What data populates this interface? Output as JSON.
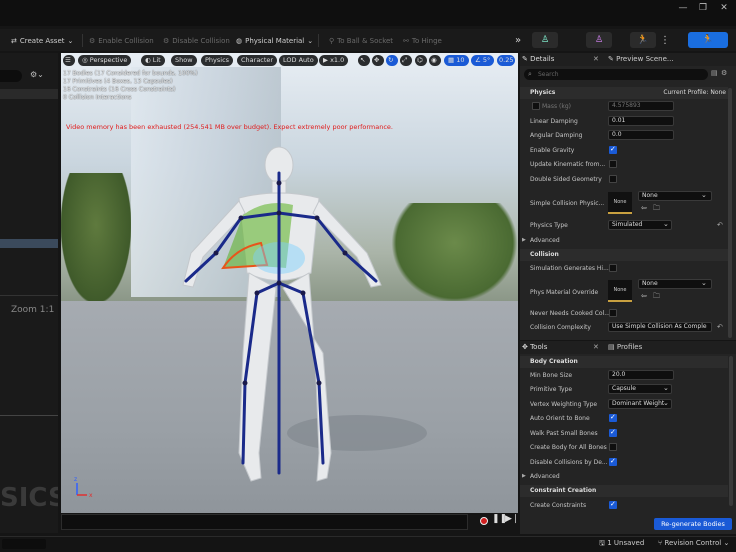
{
  "window": {
    "minimize": "—",
    "restore": "❐",
    "close": "✕"
  },
  "toolbar": {
    "create_asset": "Create Asset",
    "enable_collision": "Enable Collision",
    "disable_collision": "Disable Collision",
    "physical_material": "Physical Material",
    "to_ball_socket": "To Ball & Socket",
    "to_hinge": "To Hinge"
  },
  "left_panel": {
    "zoom": "Zoom 1:1",
    "watermark": "SICS"
  },
  "viewport": {
    "buttons": {
      "perspective": "Perspective",
      "lit": "Lit",
      "show": "Show",
      "physics": "Physics",
      "character": "Character",
      "lod": "LOD Auto",
      "play_speed": "x1.0",
      "grid": "10",
      "angle": "5°",
      "scale": "0.25"
    },
    "stats": [
      "17 Bodies (17 Considered for bounds, 100%)",
      "17 Primitives (4 Boxes, 13 Capsules)",
      "16 Constraints (16 Cross Constraints)",
      "0 Collision Interactions"
    ],
    "warning": "Video memory has been exhausted (254.541 MB over budget). Expect extremely poor performance."
  },
  "details": {
    "tab_details": "Details",
    "tab_preview": "Preview Scene...",
    "search_placeholder": "Search",
    "physics_section": "Physics",
    "current_profile": "Current Profile: None",
    "mass_label": "Mass (kg)",
    "mass_value": "4.575893",
    "linear_damping_label": "Linear Damping",
    "linear_damping_value": "0.01",
    "angular_damping_label": "Angular Damping",
    "angular_damping_value": "0.0",
    "enable_gravity": "Enable Gravity",
    "update_kinematic": "Update Kinematic from...",
    "double_sided": "Double Sided Geometry",
    "simple_collision_label": "Simple Collision Physic...",
    "simple_collision_thumb": "None",
    "simple_collision_value": "None",
    "physics_type_label": "Physics Type",
    "physics_type_value": "Simulated",
    "advanced": "Advanced",
    "collision_section": "Collision",
    "sim_generates_hit": "Simulation Generates Hi...",
    "phys_material_label": "Phys Material Override",
    "phys_material_thumb": "None",
    "phys_material_value": "None",
    "never_cooked": "Never Needs Cooked Col...",
    "collision_complexity_label": "Collision Complexity",
    "collision_complexity_value": "Use Simple Collision As Comple"
  },
  "tools": {
    "tab_tools": "Tools",
    "tab_profiles": "Profiles",
    "body_creation": "Body Creation",
    "min_bone_size_label": "Min Bone Size",
    "min_bone_size_value": "20.0",
    "primitive_type_label": "Primitive Type",
    "primitive_type_value": "Capsule",
    "vertex_weighting_label": "Vertex Weighting Type",
    "vertex_weighting_value": "Dominant Weight",
    "auto_orient": "Auto Orient to Bone",
    "walk_past": "Walk Past Small Bones",
    "create_body_all": "Create Body for All Bones",
    "disable_collisions": "Disable Collisions by De...",
    "advanced": "Advanced",
    "constraint_creation": "Constraint Creation",
    "create_constraints": "Create Constraints",
    "regenerate": "Re-generate Bodies"
  },
  "statusbar": {
    "unsaved": "1 Unsaved",
    "revision": "Revision Control"
  }
}
